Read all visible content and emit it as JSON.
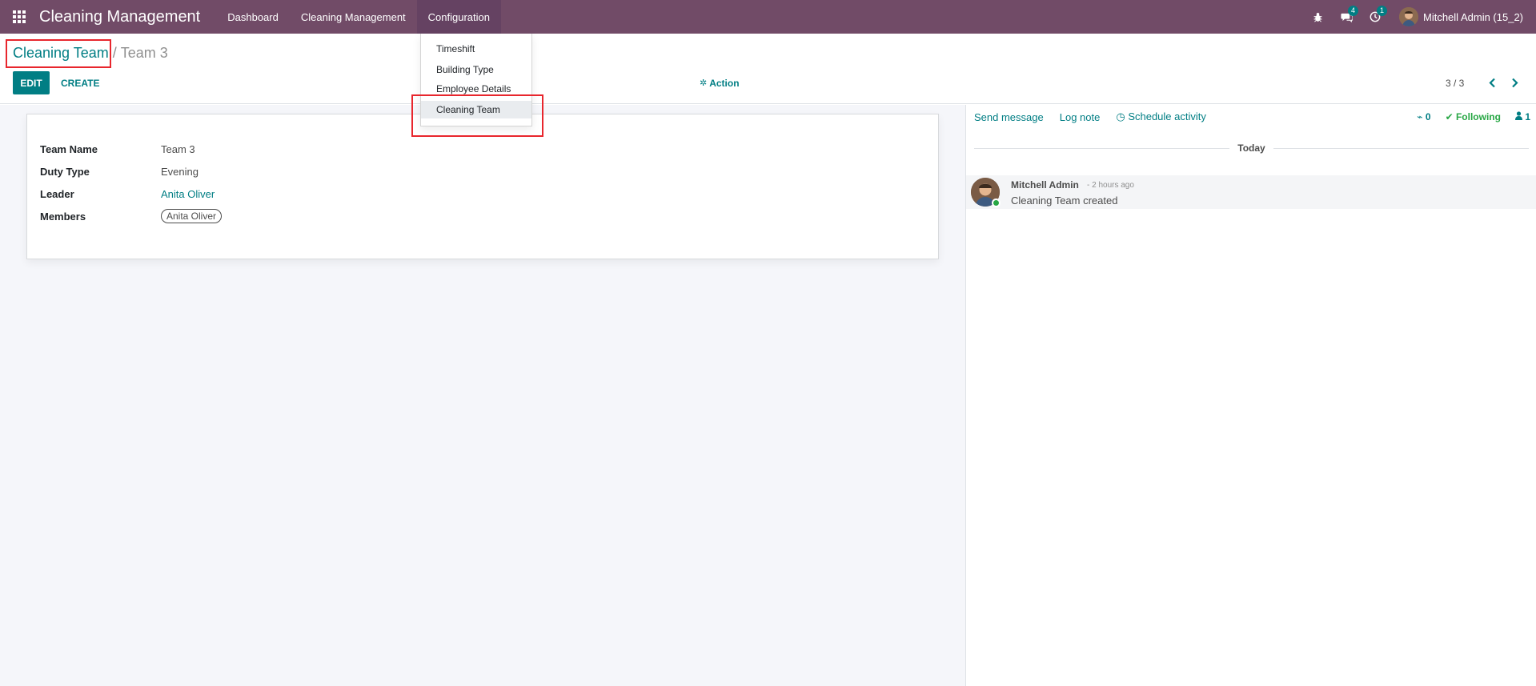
{
  "navbar": {
    "app_title": "Cleaning Management",
    "menu": [
      "Dashboard",
      "Cleaning Management",
      "Configuration"
    ],
    "messages_count": "4",
    "activities_count": "1",
    "user_name": "Mitchell Admin (15_2)"
  },
  "configuration_menu": {
    "items": [
      "Timeshift",
      "Building Type",
      "Employee Details",
      "Cleaning Team"
    ]
  },
  "breadcrumb": {
    "parent": "Cleaning Team",
    "separator": "/",
    "current": "Team 3"
  },
  "toolbar": {
    "edit_label": "EDIT",
    "create_label": "CREATE",
    "action_label": "Action",
    "pager": "3 / 3"
  },
  "form": {
    "team_name_label": "Team Name",
    "team_name": "Team 3",
    "duty_type_label": "Duty Type",
    "duty_type": "Evening",
    "leader_label": "Leader",
    "leader": "Anita Oliver",
    "members_label": "Members",
    "members": [
      "Anita Oliver"
    ]
  },
  "chatter": {
    "send_message": "Send message",
    "log_note": "Log note",
    "schedule_activity": "Schedule activity",
    "attachments_count": "0",
    "following_label": "Following",
    "followers_count": "1",
    "date_separator": "Today",
    "messages": [
      {
        "author": "Mitchell Admin",
        "date": "- 2 hours ago",
        "body": "Cleaning Team created"
      }
    ]
  },
  "colors": {
    "navbar": "#714b67",
    "accent": "#017e84",
    "highlight": "#e8262d",
    "following": "#28a745"
  }
}
